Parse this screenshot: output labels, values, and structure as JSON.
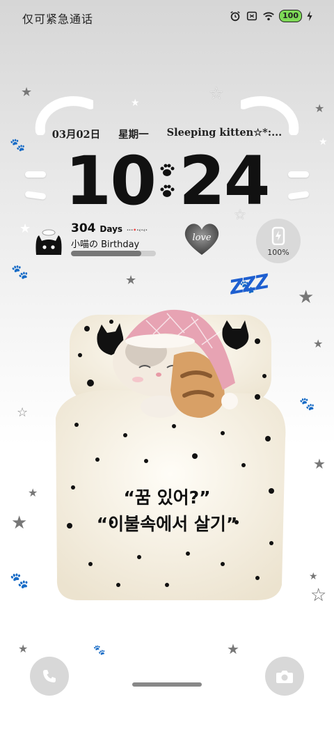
{
  "status_bar": {
    "carrier_text": "仅可紧急通话",
    "battery_label": "100",
    "icons": [
      "alarm-icon",
      "sim-icon",
      "wifi-icon",
      "battery-icon",
      "charging-icon"
    ]
  },
  "date_line": {
    "date": "03月02日",
    "weekday": "星期一",
    "caption": "Sleeping kitten☆*:..."
  },
  "clock": {
    "hours": "10",
    "minutes": "24"
  },
  "countdown": {
    "days_number": "304",
    "days_unit": "Days",
    "label": "小喵の Birthday",
    "progress_fraction": 0.83
  },
  "love_widget": {
    "text": "love"
  },
  "battery_widget": {
    "percent": "100%"
  },
  "illustration": {
    "sleep_text": "ZZZ"
  },
  "quote": {
    "line1": "“꿈 있어?”",
    "line2": "“이불속에서 살기”"
  },
  "shortcuts": {
    "left_icon": "phone-icon",
    "right_icon": "camera-icon"
  },
  "colors": {
    "accent_blue": "#1e5fd0",
    "hat_pink": "#e7a3b3",
    "bed_cream": "#f7f1e3"
  }
}
